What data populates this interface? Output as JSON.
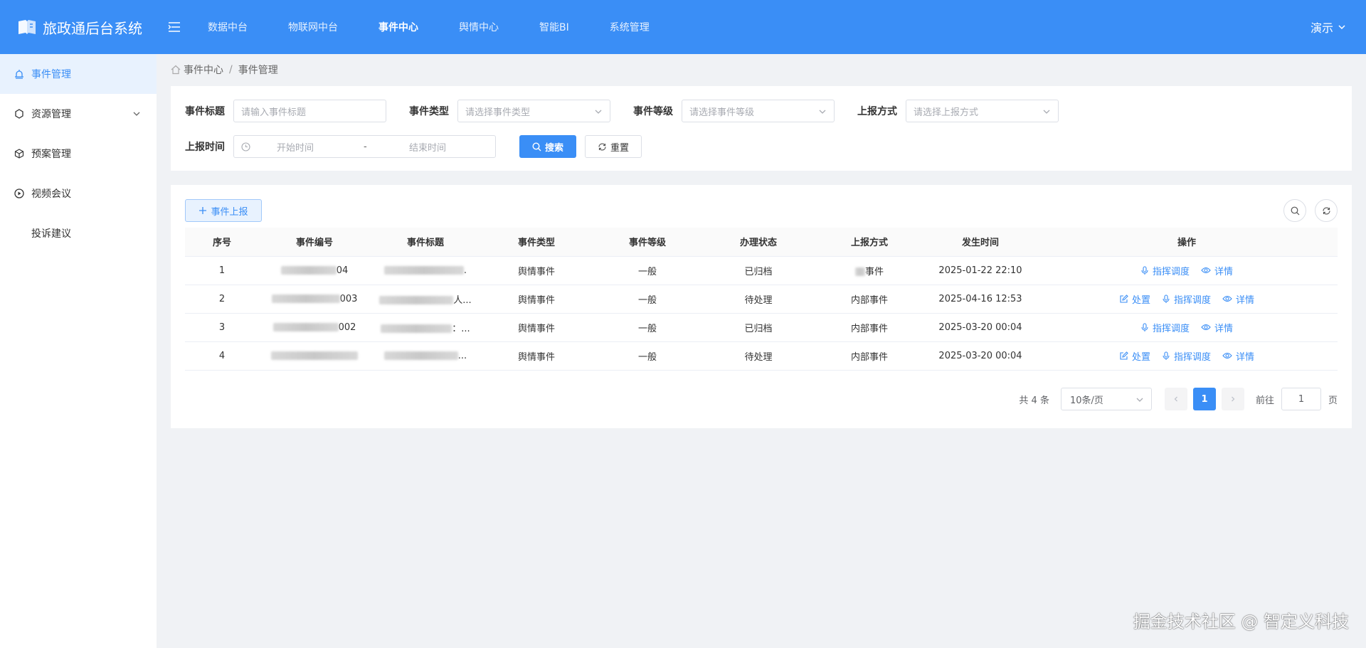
{
  "header": {
    "app_title": "旅政通后台系统",
    "nav": [
      "数据中台",
      "物联网中台",
      "事件中心",
      "舆情中心",
      "智能BI",
      "系统管理"
    ],
    "active_nav": "事件中心",
    "user": "演示"
  },
  "sidebar": {
    "items": [
      {
        "label": "事件管理",
        "icon": "bell-icon",
        "active": true
      },
      {
        "label": "资源管理",
        "icon": "resource-icon",
        "expandable": true
      },
      {
        "label": "预案管理",
        "icon": "plan-icon"
      },
      {
        "label": "视频会议",
        "icon": "video-icon"
      },
      {
        "label": "投诉建议",
        "icon": ""
      }
    ]
  },
  "breadcrumb": {
    "parent": "事件中心",
    "sep": "/",
    "current": "事件管理"
  },
  "filters": {
    "title_label": "事件标题",
    "title_placeholder": "请输入事件标题",
    "type_label": "事件类型",
    "type_placeholder": "请选择事件类型",
    "level_label": "事件等级",
    "level_placeholder": "请选择事件等级",
    "method_label": "上报方式",
    "method_placeholder": "请选择上报方式",
    "time_label": "上报时间",
    "start_placeholder": "开始时间",
    "range_sep": "-",
    "end_placeholder": "结束时间",
    "search_label": "搜索",
    "reset_label": "重置"
  },
  "toolbar": {
    "report_label": "事件上报"
  },
  "table": {
    "columns": [
      "序号",
      "事件编号",
      "事件标题",
      "事件类型",
      "事件等级",
      "办理状态",
      "上报方式",
      "发生时间",
      "操作"
    ],
    "rows": [
      {
        "no": "1",
        "code": "04",
        "title": ".",
        "type": "舆情事件",
        "level": "一般",
        "status": "已归档",
        "method": "事件",
        "time": "2025-01-22 22:10",
        "actions": [
          "指挥调度",
          "详情"
        ]
      },
      {
        "no": "2",
        "code": "003",
        "title": "人...",
        "type": "舆情事件",
        "level": "一般",
        "status": "待处理",
        "method": "内部事件",
        "time": "2025-04-16 12:53",
        "actions": [
          "处置",
          "指挥调度",
          "详情"
        ]
      },
      {
        "no": "3",
        "code": "002",
        "title": "：...",
        "type": "舆情事件",
        "level": "一般",
        "status": "已归档",
        "method": "内部事件",
        "time": "2025-03-20 00:04",
        "actions": [
          "指挥调度",
          "详情"
        ]
      },
      {
        "no": "4",
        "code": "",
        "title": "...",
        "type": "舆情事件",
        "level": "一般",
        "status": "待处理",
        "method": "内部事件",
        "time": "2025-03-20 00:04",
        "actions": [
          "处置",
          "指挥调度",
          "详情"
        ]
      }
    ]
  },
  "pagination": {
    "total_text": "共 4 条",
    "page_size": "10条/页",
    "current_page": "1",
    "goto_label": "前往",
    "goto_value": "1",
    "page_suffix": "页"
  },
  "watermark": "掘金技术社区 @ 智定义科技",
  "colors": {
    "primary": "#3a8ef6",
    "header_bg": "#3a8ef6",
    "page_bg": "#f0f2f5",
    "active_menu_bg": "#e8f2fe"
  }
}
